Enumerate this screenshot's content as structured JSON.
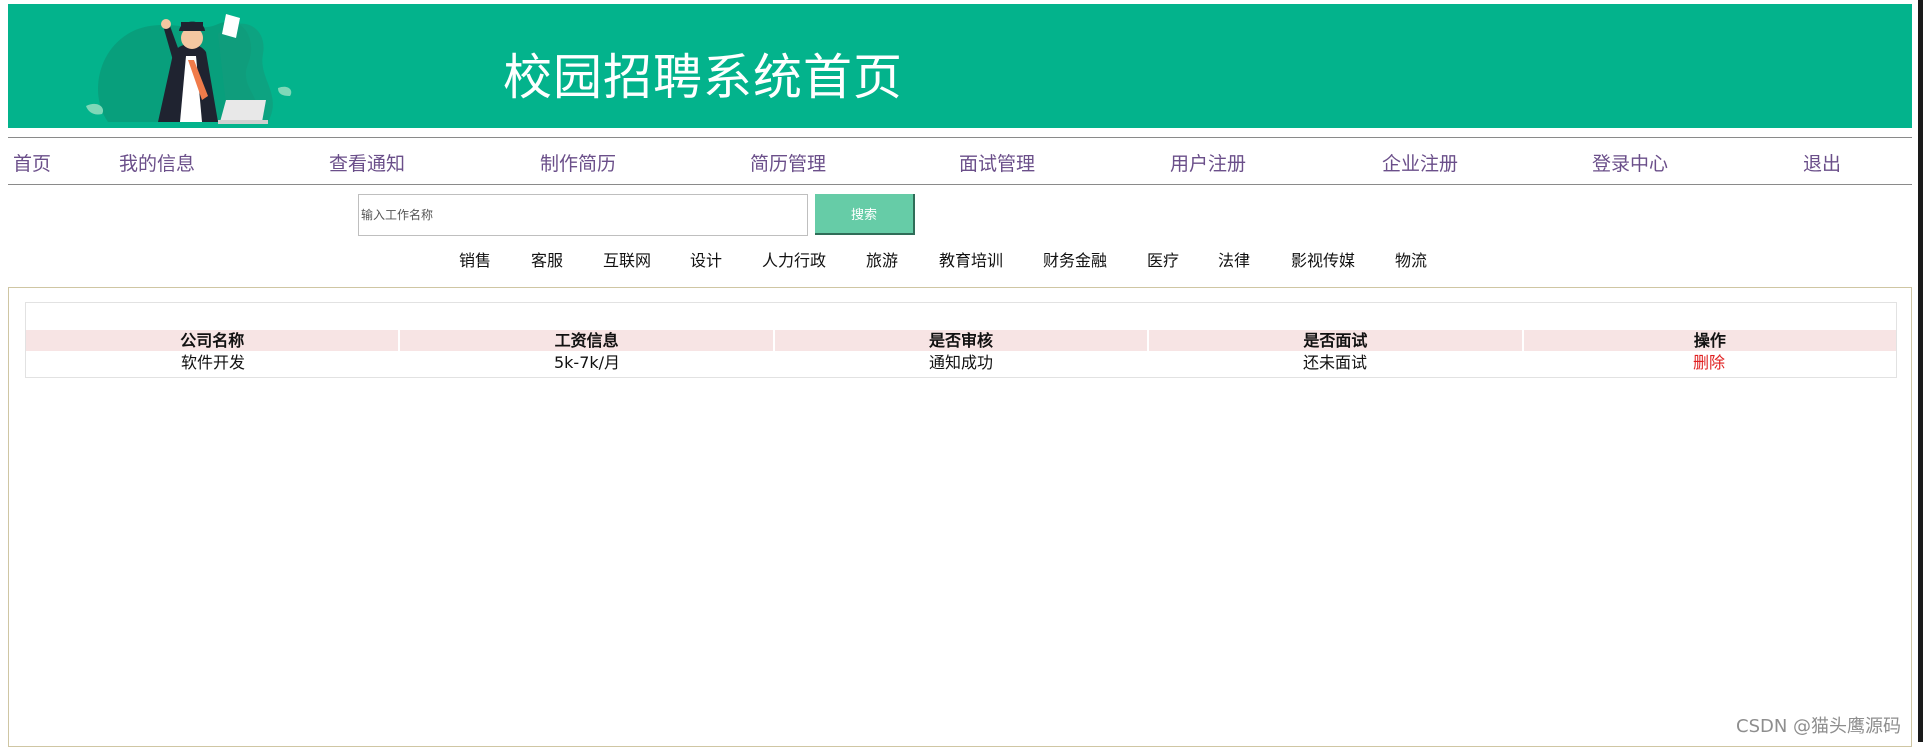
{
  "header": {
    "title": "校园招聘系统首页",
    "background_color": "#03b38c"
  },
  "nav": {
    "items": [
      {
        "label": "首页"
      },
      {
        "label": "我的信息"
      },
      {
        "label": "查看通知"
      },
      {
        "label": "制作简历"
      },
      {
        "label": "简历管理"
      },
      {
        "label": "面试管理"
      },
      {
        "label": "用户注册"
      },
      {
        "label": "企业注册"
      },
      {
        "label": "登录中心"
      },
      {
        "label": "退出"
      }
    ],
    "link_color": "#6b4f8a"
  },
  "search": {
    "placeholder": "输入工作名称",
    "value": "",
    "button_label": "搜索",
    "button_color": "#66cca7"
  },
  "categories": [
    "销售",
    "客服",
    "互联网",
    "设计",
    "人力行政",
    "旅游",
    "教育培训",
    "财务金融",
    "医疗",
    "法律",
    "影视传媒",
    "物流"
  ],
  "table": {
    "headers": [
      "公司名称",
      "工资信息",
      "是否审核",
      "是否面试",
      "操作"
    ],
    "header_bg": "#f7e4e4",
    "rows": [
      [
        "软件开发",
        "5k-7k/月",
        "通知成功",
        "还未面试",
        "删除"
      ]
    ],
    "action_color": "#e02020"
  },
  "watermark": "CSDN @猫头鹰源码"
}
